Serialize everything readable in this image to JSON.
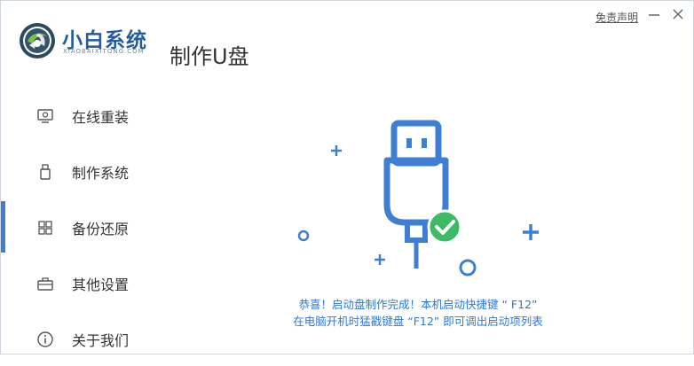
{
  "app": {
    "name": "小白系统",
    "subtitle": "XIAOBAIXITONG.COM",
    "page_title": "制作U盘",
    "disclaimer": "免责声明"
  },
  "sidebar": {
    "items": [
      {
        "label": "在线重装",
        "icon": "monitor-icon",
        "active": false
      },
      {
        "label": "制作系统",
        "icon": "usb-drive-icon",
        "active": false
      },
      {
        "label": "备份还原",
        "icon": "grid-icon",
        "active": true
      },
      {
        "label": "其他设置",
        "icon": "toolbox-icon",
        "active": false
      },
      {
        "label": "关于我们",
        "icon": "info-icon",
        "active": false
      }
    ]
  },
  "main": {
    "message_line1": "恭喜！启动盘制作完成！本机启动快捷键 “ F12”",
    "message_line2": "在电脑开机时猛戳键盘 “F12” 即可调出启动项列表"
  },
  "colors": {
    "accent": "#3f7fd3",
    "brand": "#235d9c",
    "success": "#3dbb64",
    "message": "#2d78d4"
  }
}
